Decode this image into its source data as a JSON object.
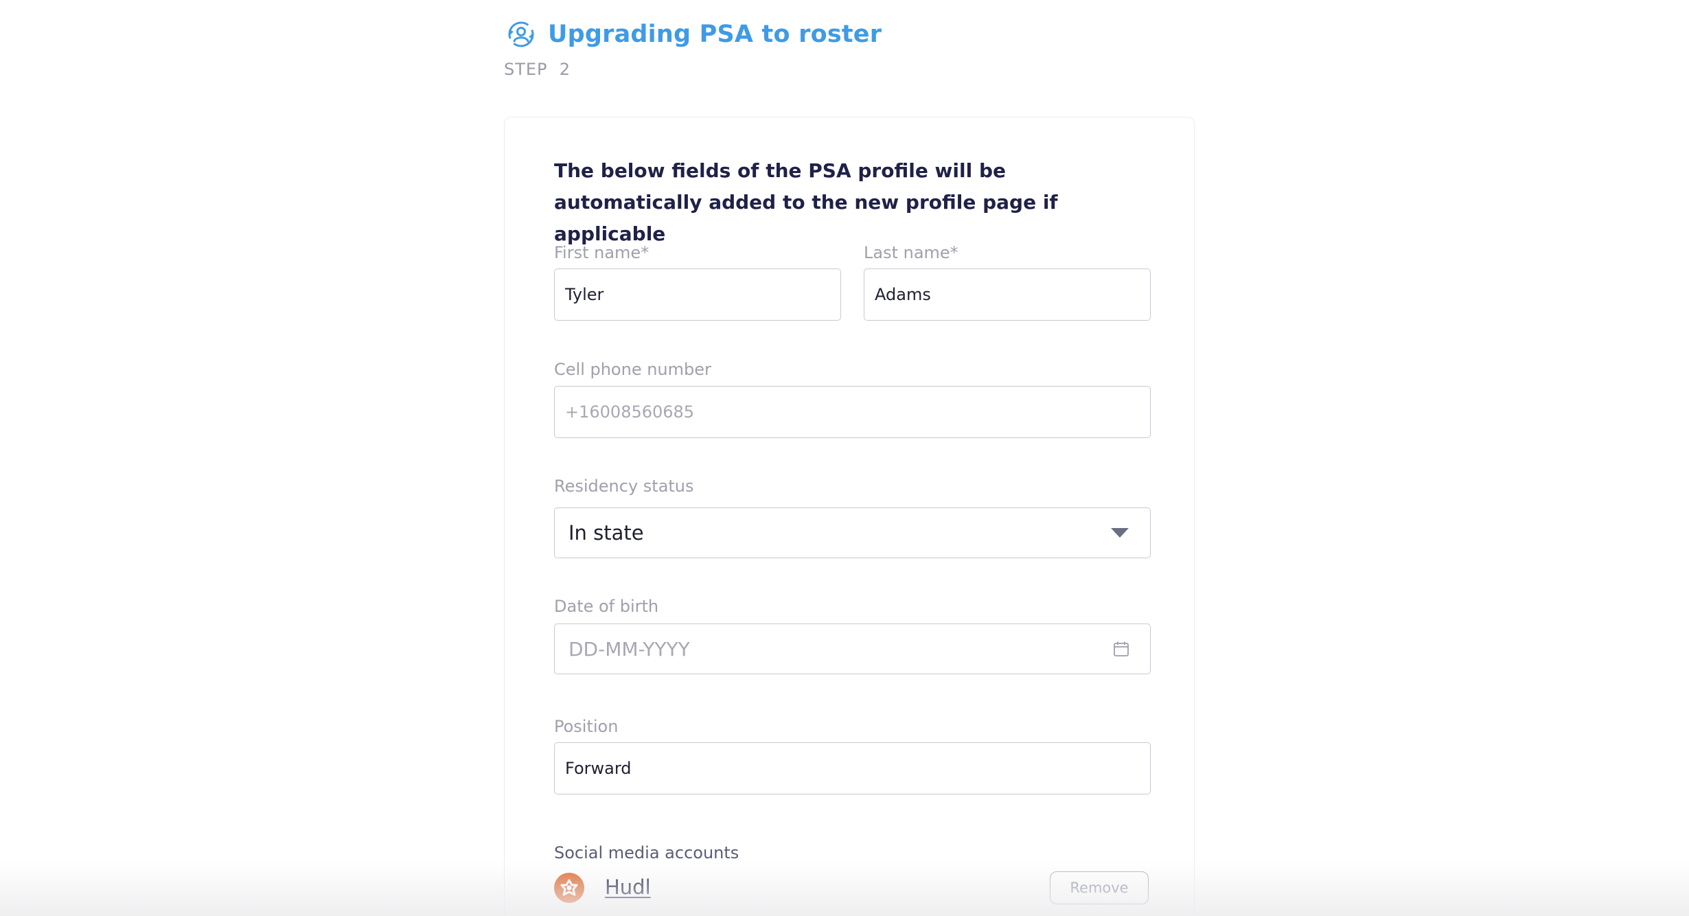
{
  "header": {
    "title": "Upgrading PSA to roster",
    "icon": "user-sync-icon",
    "accent_color": "#3f9be5"
  },
  "step": {
    "label": "STEP",
    "number": "2"
  },
  "card": {
    "intro": "The below fields of the PSA profile will be automatically added to the new profile page if applicable"
  },
  "form": {
    "first_name": {
      "label": "First name*",
      "value": "Tyler"
    },
    "last_name": {
      "label": "Last name*",
      "value": "Adams"
    },
    "cell_phone": {
      "label": "Cell phone number",
      "placeholder": "+16008560685"
    },
    "residency": {
      "label": "Residency status",
      "selected": "In state"
    },
    "dob": {
      "label": "Date of birth",
      "placeholder": "DD-MM-YYYY",
      "icon": "calendar-icon"
    },
    "position": {
      "label": "Position",
      "value": "Forward"
    }
  },
  "social": {
    "label": "Social media accounts",
    "accounts": [
      {
        "name": "Hudl",
        "icon": "hudl-logo",
        "color": "#e1703a",
        "remove_label": "Remove"
      }
    ]
  }
}
